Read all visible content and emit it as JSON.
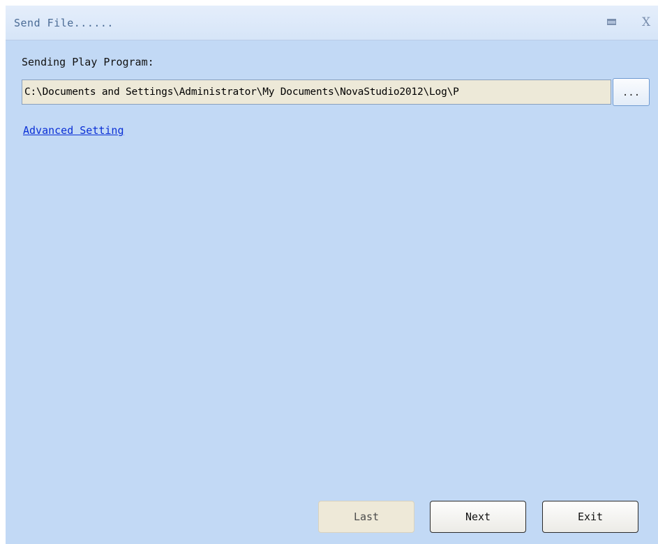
{
  "window": {
    "title": "Send File......",
    "minimize_glyph": "",
    "close_glyph": "X"
  },
  "form": {
    "section_label": "Sending Play Program:",
    "path_value": "C:\\Documents and Settings\\Administrator\\My Documents\\NovaStudio2012\\Log\\P",
    "browse_label": "...",
    "advanced_link": "Advanced Setting"
  },
  "footer": {
    "last_label": "Last",
    "next_label": "Next",
    "exit_label": "Exit"
  },
  "colors": {
    "background": "#c2d9f5",
    "titlebar": "#e0eafa",
    "link": "#0a2fd6",
    "field_bg": "#ede9d8"
  },
  "icons": {
    "minimize": "minimize-icon",
    "close": "close-icon"
  }
}
